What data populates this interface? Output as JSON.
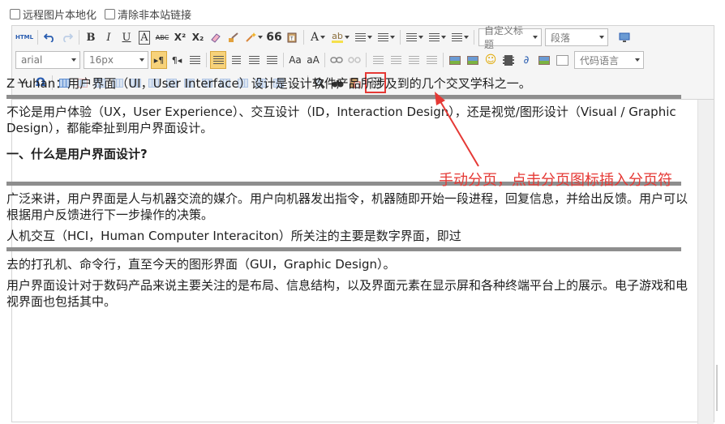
{
  "options": {
    "remote_image_label": "远程图片本地化",
    "clear_links_label": "清除非本站链接"
  },
  "toolbar": {
    "html_label": "HTML",
    "bold": "B",
    "italic": "I",
    "underline": "U",
    "abc": "ABC",
    "sup": "X²",
    "sub": "X₂",
    "quote": "66",
    "font_color": "A",
    "custom_title": "自定义标题",
    "paragraph": "段落",
    "font_family": "arial",
    "font_size": "16px",
    "code_language": "代码语言",
    "omega": "Ω",
    "hr": "—"
  },
  "content": {
    "p1": "Z Yuhan：用户界面（UI，User Interface）设计是设计软件产品所涉及到的几个交叉学科之一。",
    "p2": "不论是用户体验（UX，User Experience）、交互设计（ID，Interaction Design），还是视觉/图形设计（Visual / Graphic Design），都能牵扯到用户界面设计。",
    "h2": "一、什么是用户界面设计?",
    "p3": "广泛来讲，用户界面是人与机器交流的媒介。用户向机器发出指令，机器随即开始一段进程，回复信息，并给出反馈。用户可以根据用户反馈进行下一步操作的决策。",
    "p4": "人机交互（HCI，Human Computer Interaciton）所关注的主要是数字界面，即过",
    "p5": "去的打孔机、命令行，直至今天的图形界面（GUI，Graphic Design）。",
    "p6": "用户界面设计对于数码产品来说主要关注的是布局、信息结构，以及界面元素在显示屏和各种终端平台上的展示。电子游戏和电视界面也包括其中。"
  },
  "annotation": "手动分页，点击分页图标插入分页符",
  "colors": {
    "annotation": "#e53935",
    "active": "#f7d27a",
    "pagebreak": "#8e8e8e"
  }
}
